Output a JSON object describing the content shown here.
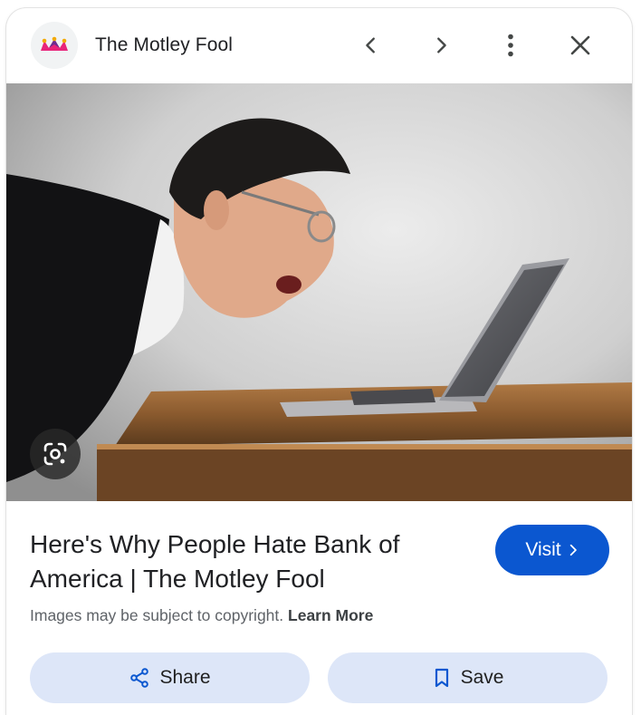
{
  "header": {
    "site_name": "The Motley Fool",
    "logo_icon": "motley-fool-jester-logo",
    "back_icon": "chevron-left-icon",
    "forward_icon": "chevron-right-icon",
    "menu_icon": "more-vert-icon",
    "close_icon": "close-icon"
  },
  "image": {
    "subject": "man-yelling-at-laptop-photo",
    "lens_icon": "google-lens-icon"
  },
  "result": {
    "title": "Here's Why People Hate Bank of America | The Motley Fool",
    "visit_label": "Visit",
    "copyright_text": "Images may be subject to copyright.",
    "learn_more_label": "Learn More"
  },
  "actions": {
    "share_label": "Share",
    "save_label": "Save"
  },
  "colors": {
    "accent": "#0b57d0",
    "pill_bg": "#dde6f8",
    "text": "#202124",
    "muted": "#5f6368"
  }
}
